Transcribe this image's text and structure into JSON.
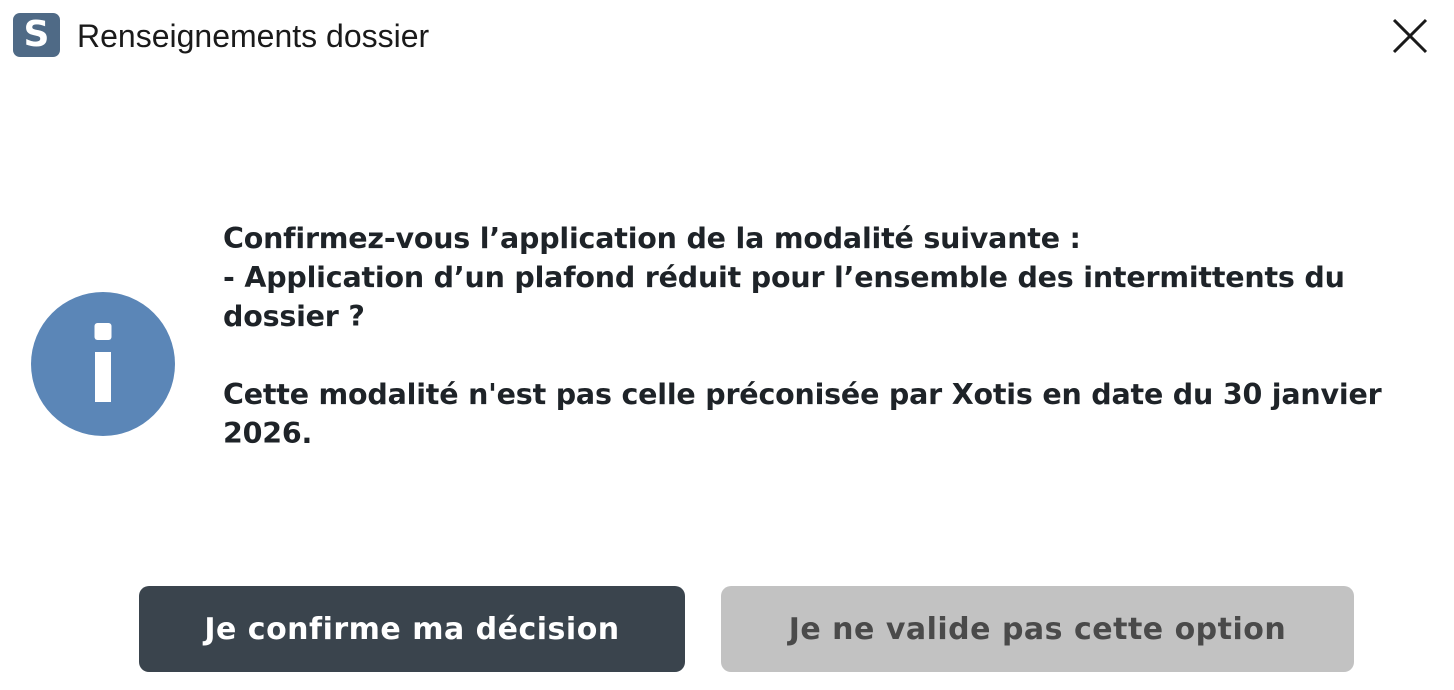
{
  "window": {
    "title": "Renseignements dossier",
    "app_icon_letter": "S",
    "app_icon_color": "#4f6a86",
    "close_icon": "close-icon"
  },
  "dialog": {
    "icon": "info-icon",
    "icon_color": "#5b86b7",
    "message": {
      "line1": "Confirmez-vous l’application de la modalité suivante :",
      "line2": "- Application d’un plafond réduit pour l’ensemble des intermittents du dossier ?",
      "line3": "Cette modalité n'est pas celle préconisée par Xotis en date du 30 janvier 2026."
    }
  },
  "buttons": {
    "confirm_label": "Je confirme ma décision",
    "confirm_color": "#3a444d",
    "reject_label": "Je ne valide pas cette option",
    "reject_color": "#c2c2c2"
  }
}
